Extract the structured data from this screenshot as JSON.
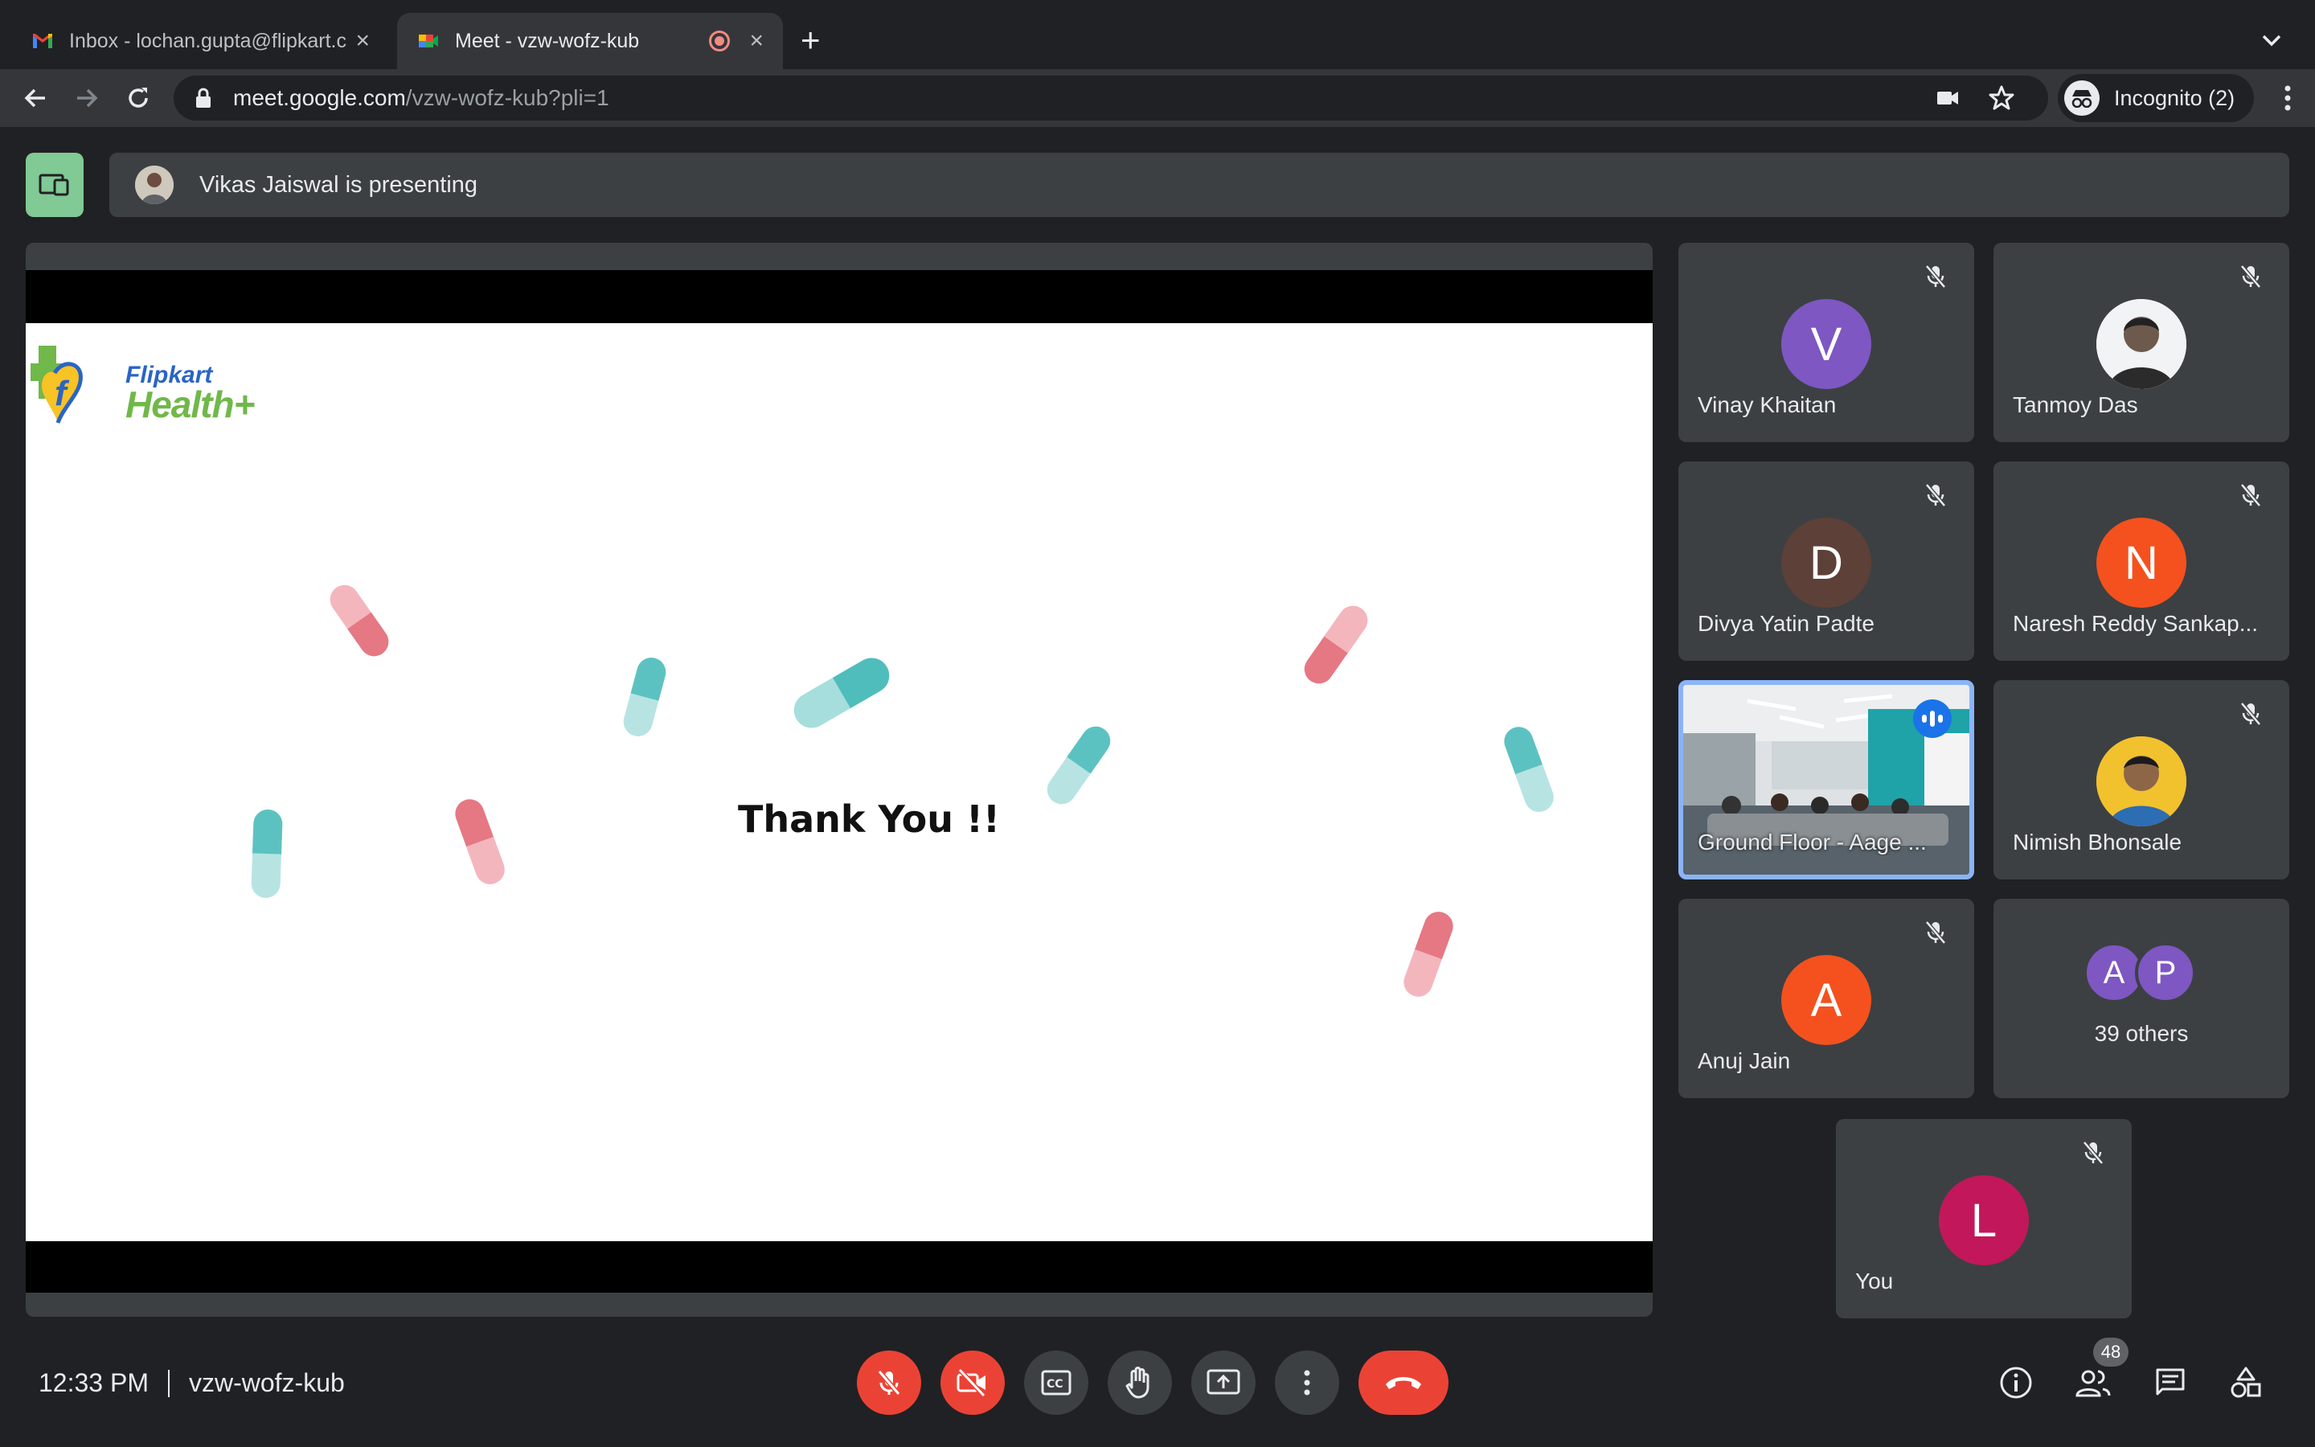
{
  "browser": {
    "tabs": [
      {
        "title": "Inbox - lochan.gupta@flipkart.c",
        "icon": "gmail-icon",
        "active": false
      },
      {
        "title": "Meet - vzw-wofz-kub",
        "icon": "meet-icon",
        "active": true
      }
    ],
    "url_host": "meet.google.com",
    "url_path": "/vzw-wofz-kub?pli=1",
    "incognito_label": "Incognito (2)"
  },
  "meeting": {
    "presenting_text": "Vikas Jaiswal is presenting",
    "slide": {
      "logo_line1": "Flipkart",
      "logo_line2": "Health+",
      "text": "Thank You !!"
    },
    "participants": [
      {
        "name": "Vinay Khaitan",
        "initial": "V",
        "color": "#7e57c2",
        "muted": true
      },
      {
        "name": "Tanmoy Das",
        "initial": "",
        "photo": true,
        "muted": true
      },
      {
        "name": "Divya Yatin Padte",
        "initial": "D",
        "color": "#5d4037",
        "muted": true
      },
      {
        "name": "Naresh Reddy Sankap...",
        "initial": "N",
        "color": "#f4511e",
        "muted": true
      },
      {
        "name": "Ground Floor - Aage ...",
        "video": true,
        "speaking": true
      },
      {
        "name": "Nimish Bhonsale",
        "initial": "",
        "photo": true,
        "muted": true
      },
      {
        "name": "Anuj Jain",
        "initial": "A",
        "color": "#f4511e",
        "muted": true
      }
    ],
    "others": {
      "initials": [
        "A",
        "P"
      ],
      "colors": [
        "#7e57c2",
        "#7e57c2"
      ],
      "label": "39 others"
    },
    "self": {
      "name": "You",
      "initial": "L",
      "color": "#c2185b",
      "muted": true
    },
    "time": "12:33 PM",
    "code": "vzw-wofz-kub",
    "people_count": "48",
    "colors": {
      "end_call": "#ea4335",
      "accent": "#8ab4f8",
      "present": "#81c995"
    }
  }
}
